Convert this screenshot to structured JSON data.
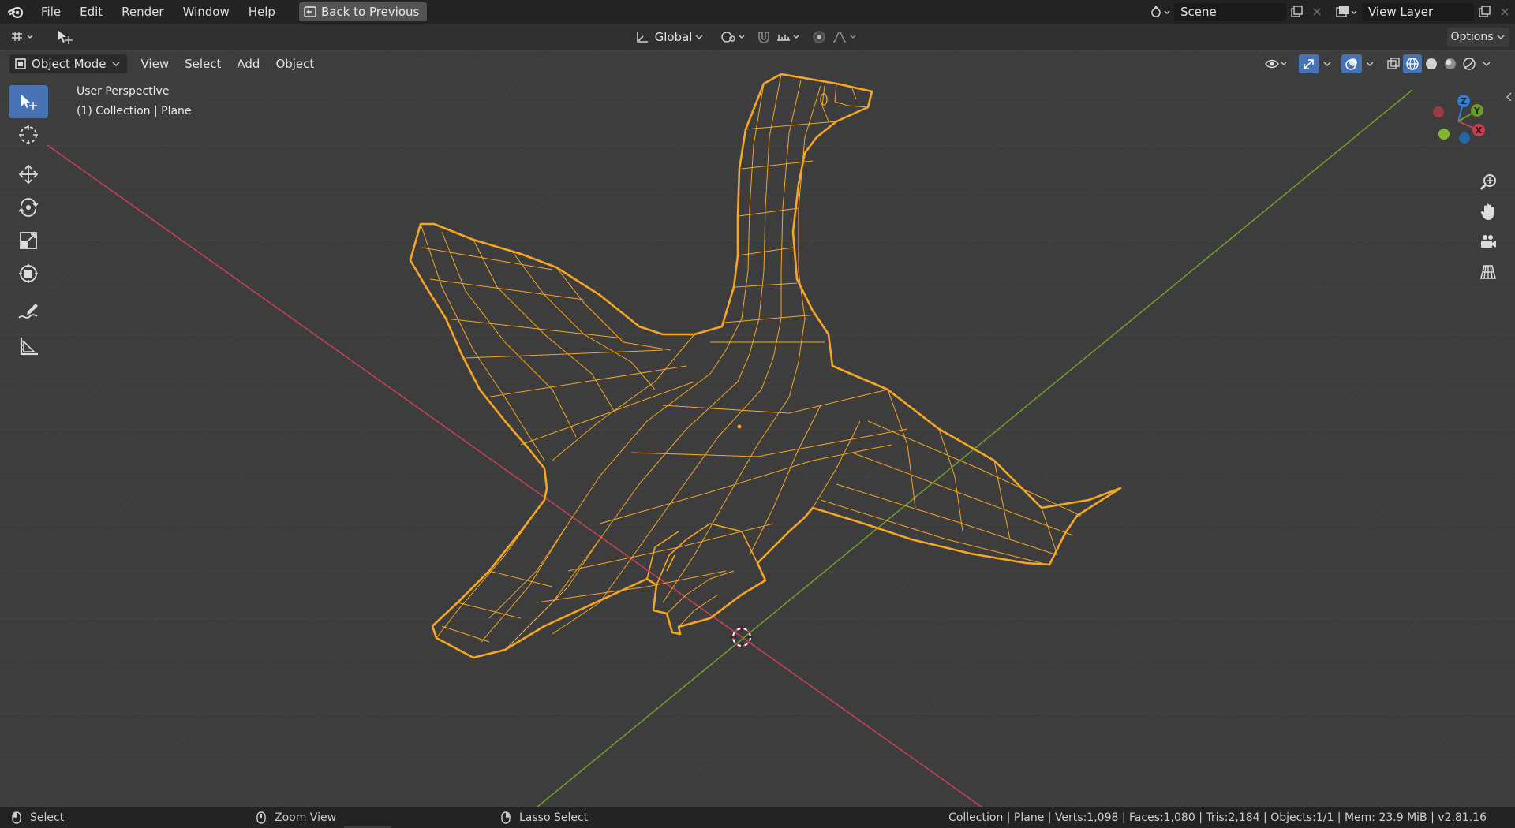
{
  "menubar": {
    "items": [
      "File",
      "Edit",
      "Render",
      "Window",
      "Help"
    ],
    "back_button": "Back to Previous",
    "scene": "Scene",
    "view_layer": "View Layer"
  },
  "tool_header": {
    "transform_orientation": "Global",
    "options": "Options"
  },
  "viewport_header": {
    "mode": "Object Mode",
    "menus": [
      "View",
      "Select",
      "Add",
      "Object"
    ]
  },
  "viewport": {
    "perspective": "User Perspective",
    "collection_info": "(1) Collection | Plane",
    "gizmo_axes": {
      "x": "X",
      "y": "Y",
      "z": "Z"
    }
  },
  "statusbar": {
    "select": "Select",
    "zoom_view": "Zoom View",
    "lasso_select": "Lasso Select",
    "stats": "Collection | Plane | Verts:1,098 | Faces:1,080 | Tris:2,184 | Objects:1/1 | Mem: 23.9 MiB | v2.81.16"
  },
  "colors": {
    "accent": "#4772b3",
    "selection": "#f5a623",
    "x_axis": "#c34054",
    "y_axis": "#6e9c2a",
    "z_axis": "#2f80d4"
  }
}
